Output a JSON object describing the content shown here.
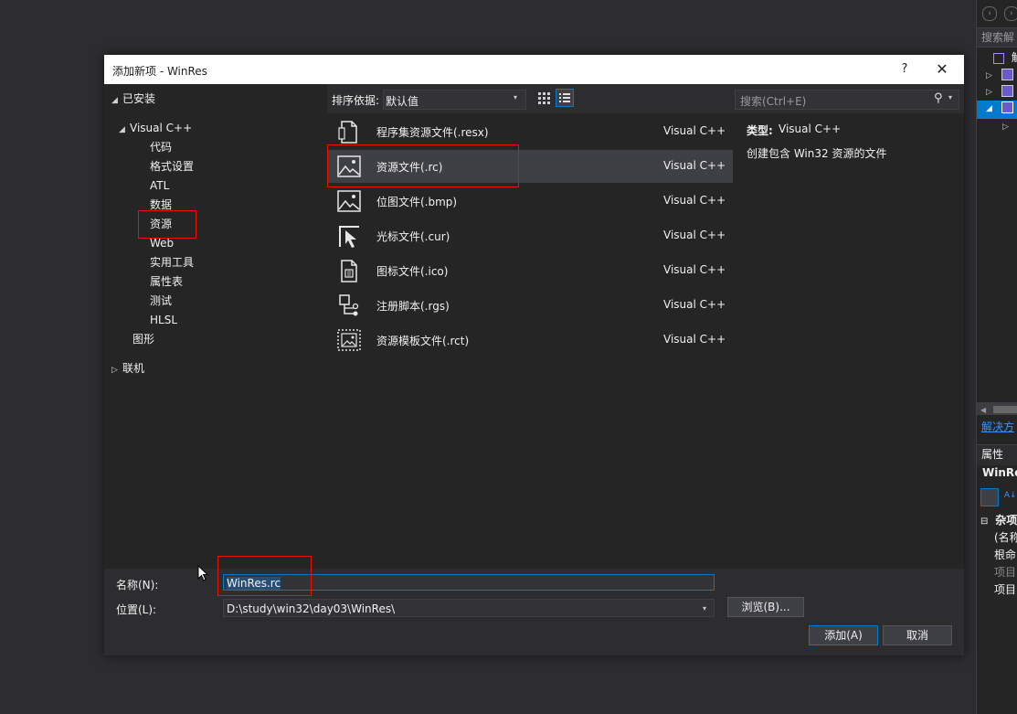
{
  "dialog": {
    "title": "添加新项 - WinRes",
    "help": "?",
    "close": "✕"
  },
  "tree": {
    "installed": "已安装",
    "visual_cpp": "Visual C++",
    "children": [
      "代码",
      "格式设置",
      "ATL",
      "数据",
      "资源",
      "Web",
      "实用工具",
      "属性表",
      "测试",
      "HLSL"
    ],
    "graphics": "图形",
    "online": "联机"
  },
  "toolbar": {
    "sort_label": "排序依据:",
    "sort_value": "默认值",
    "search_placeholder": "搜索(Ctrl+E)"
  },
  "items": [
    {
      "name": "程序集资源文件(.resx)",
      "lang": "Visual C++",
      "icon": "resx-file-icon"
    },
    {
      "name": "资源文件(.rc)",
      "lang": "Visual C++",
      "icon": "image-file-icon"
    },
    {
      "name": "位图文件(.bmp)",
      "lang": "Visual C++",
      "icon": "image-file-icon"
    },
    {
      "name": "光标文件(.cur)",
      "lang": "Visual C++",
      "icon": "cursor-file-icon"
    },
    {
      "name": "图标文件(.ico)",
      "lang": "Visual C++",
      "icon": "icon-file-icon"
    },
    {
      "name": "注册脚本(.rgs)",
      "lang": "Visual C++",
      "icon": "registry-script-icon"
    },
    {
      "name": "资源模板文件(.rct)",
      "lang": "Visual C++",
      "icon": "resource-template-icon"
    }
  ],
  "desc": {
    "type_label": "类型:",
    "type_value": "Visual C++",
    "text": "创建包含 Win32 资源的文件"
  },
  "bottom": {
    "name_label": "名称(N):",
    "name_value": "WinRes.rc",
    "location_label": "位置(L):",
    "location_value": "D:\\study\\win32\\day03\\WinRes\\",
    "browse": "浏览(B)...",
    "add": "添加(A)",
    "cancel": "取消"
  },
  "side_panel": {
    "search": "搜索解",
    "root": "解",
    "solution_link": "解决方",
    "properties": "属性",
    "project": "WinRe",
    "misc": "杂项",
    "rows": [
      "(名称",
      "根命",
      "项目",
      "项目"
    ]
  },
  "colors": {
    "accent": "#007acc",
    "highlight": "#e51400",
    "dialog_bg": "#2d2d30",
    "panel_bg": "#252526"
  }
}
